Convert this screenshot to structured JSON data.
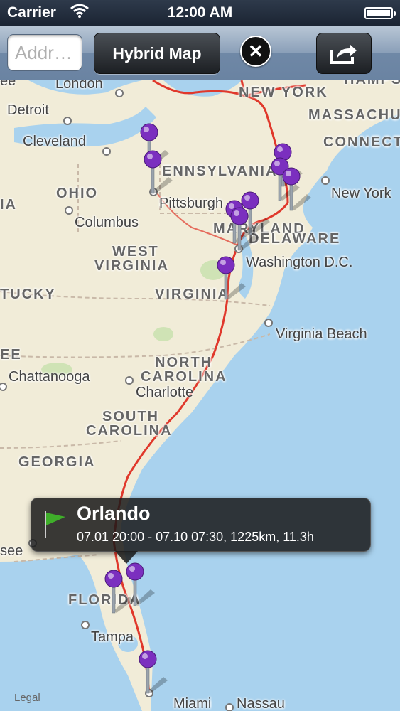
{
  "status": {
    "carrier": "Carrier",
    "time": "12:00 AM"
  },
  "toolbar": {
    "address_placeholder": "Addr…",
    "map_type_label": "Hybrid Map",
    "clear_symbol": "✕"
  },
  "map": {
    "states": [
      "NEW YORK",
      "MASSACHU",
      "CONNECTIC",
      "ENNSYLVANIA",
      "OHIO",
      "IA",
      "WEST",
      "VIRGINIA",
      "VIRGINIA",
      "MARYLAND",
      "DELAWARE",
      "TUCKY",
      "EE",
      "NORTH",
      "CAROLINA",
      "SOUTH",
      "CAROLINA",
      "GEORGIA",
      "FLORIDA",
      "HAMPS"
    ],
    "cities": [
      "ee",
      "London",
      "Detroit",
      "Cleveland",
      "Pittsburgh",
      "Columbus",
      "New York",
      "Washington D.C.",
      "Virginia Beach",
      "Chattanooga",
      "Charlotte",
      "see",
      "Tampa",
      "Miami",
      "Nassau"
    ]
  },
  "callout": {
    "title": "Orlando",
    "subtitle": "07.01 20:00 - 07.10 07:30, 1225km, 11.3h"
  },
  "legal": "Legal",
  "colors": {
    "pin": "#7b2fbf",
    "route": "#e0382b",
    "water": "#a9d2ee",
    "land": "#f1ecd8"
  }
}
